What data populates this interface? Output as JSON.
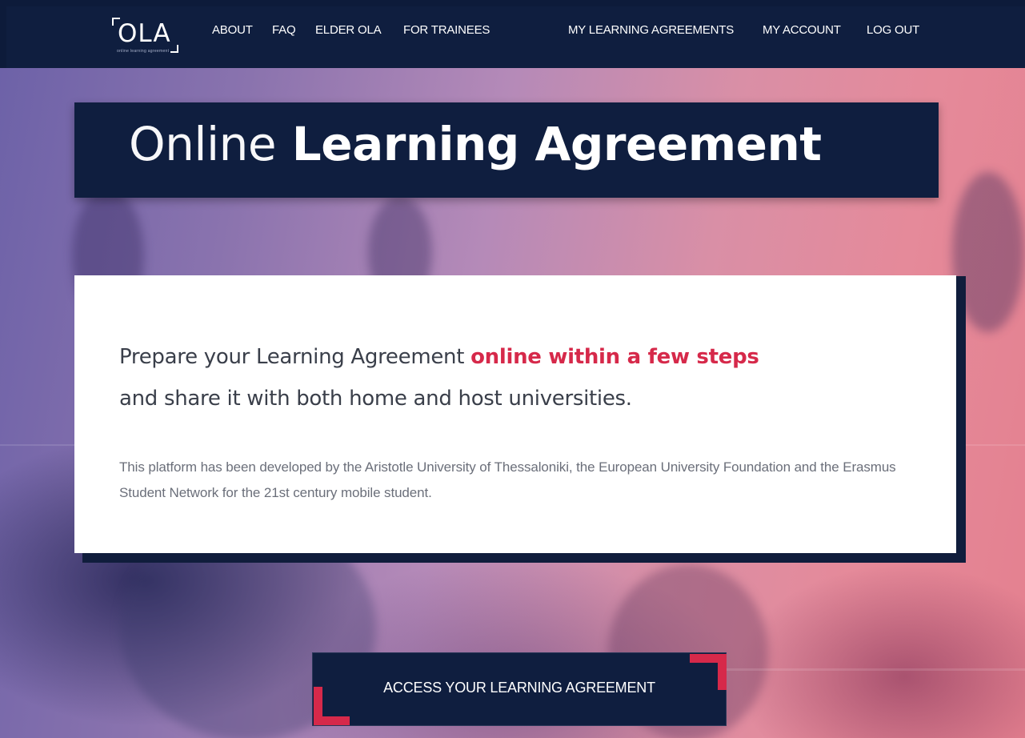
{
  "brand": {
    "logo_text": "OLA",
    "logo_subtext": "online learning agreement"
  },
  "nav": {
    "left": [
      {
        "label": "ABOUT"
      },
      {
        "label": "FAQ"
      },
      {
        "label": "ELDER OLA"
      },
      {
        "label": "FOR TRAINEES"
      }
    ],
    "right": [
      {
        "label": "MY LEARNING AGREEMENTS"
      },
      {
        "label": "MY ACCOUNT"
      },
      {
        "label": "LOG OUT"
      }
    ]
  },
  "hero": {
    "title_light": "Online",
    "title_bold": "Learning Agreement"
  },
  "intro": {
    "lead_start": "Prepare your Learning Agreement ",
    "lead_accent": "online within a few steps",
    "lead_end": "and share it with both home and host universities.",
    "description": "This platform has been developed by the Aristotle University of Thessaloniki, the European University Foundation and the Erasmus Student Network for the 21st century mobile student."
  },
  "cta": {
    "label": "ACCESS YOUR LEARNING AGREEMENT"
  },
  "colors": {
    "navy": "#0f1e3f",
    "accent": "#d6294a",
    "white": "#ffffff"
  }
}
